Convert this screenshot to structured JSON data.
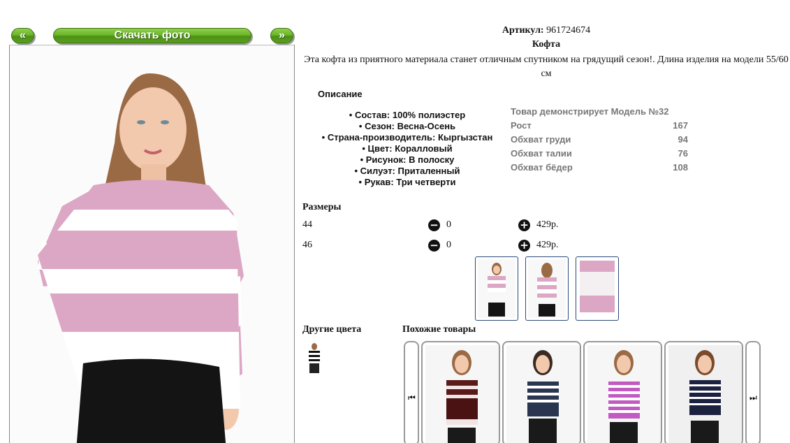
{
  "gallery": {
    "prev_label": "«",
    "download_label": "Скачать фото",
    "next_label": "»"
  },
  "product": {
    "sku_label": "Артикул:",
    "sku_value": "961724674",
    "name": "Кофта",
    "description": "Эта кофта из приятного материала станет отличным спутником на грядущий сезон!. Длина изделия на модели 55/60 см"
  },
  "details": {
    "title": "Описание",
    "properties": [
      "Состав: 100% полиэстер",
      "Сезон: Весна-Осень",
      "Страна-производитель: Кыргызстан",
      "Цвет: Коралловый",
      "Рисунок: В полоску",
      "Силуэт: Приталенный",
      "Рукав: Три четверти"
    ]
  },
  "model": {
    "title": "Товар демонстрирует Модель №32",
    "rows": [
      {
        "label": "Рост",
        "value": "167"
      },
      {
        "label": "Обхват груди",
        "value": "94"
      },
      {
        "label": "Обхват талии",
        "value": "76"
      },
      {
        "label": "Обхват бёдер",
        "value": "108"
      }
    ]
  },
  "sizes": {
    "title": "Размеры",
    "rows": [
      {
        "size": "44",
        "qty": "0",
        "price": "429р."
      },
      {
        "size": "46",
        "qty": "0",
        "price": "429р."
      }
    ]
  },
  "other_colors": {
    "title": "Другие цвета"
  },
  "similar": {
    "title": "Похожие товары"
  },
  "colors": {
    "green": "#6cb52a",
    "pink_stripe": "#dca7c4",
    "thumb_border": "#2a4a7a"
  }
}
